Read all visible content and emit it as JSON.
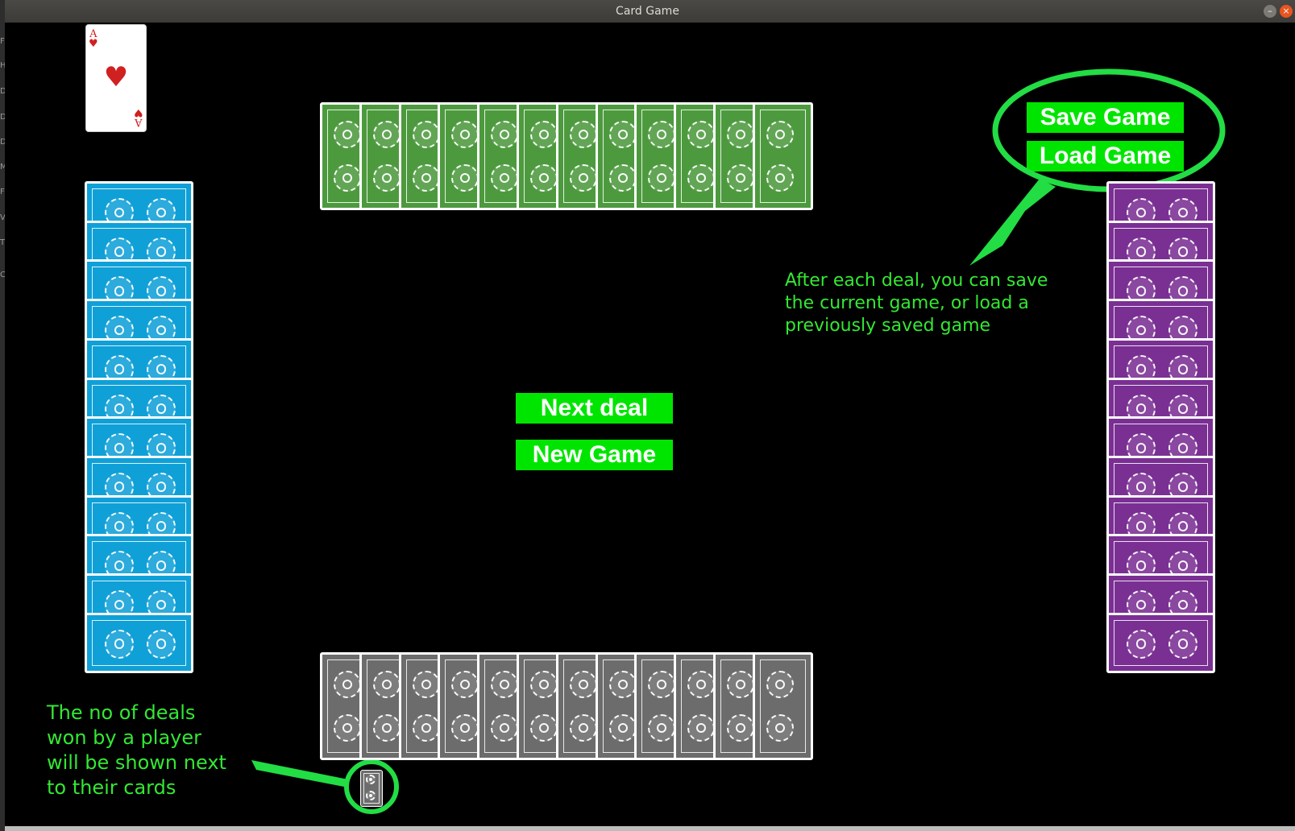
{
  "window": {
    "title": "Card Game",
    "minimize_glyph": "–",
    "close_glyph": "×"
  },
  "left_edge_letters": [
    "F",
    "H",
    "D",
    "D",
    "D",
    "M",
    "F",
    "V",
    "T",
    "C"
  ],
  "top_card": {
    "rank": "A",
    "suit": "♥",
    "suit_name": "hearts"
  },
  "buttons": {
    "save": "Save Game",
    "load": "Load Game",
    "next_deal": "Next deal",
    "new_game": "New Game"
  },
  "annotations": {
    "save_load": "After each deal, you can save\nthe current game, or load a\npreviously saved game",
    "deals_won": "The no of deals\nwon by a player\nwill be shown next\nto their cards"
  },
  "hands": {
    "top": {
      "color": "green",
      "count": 12
    },
    "bottom": {
      "color": "gray",
      "count": 12
    },
    "left": {
      "color": "blue",
      "count": 12
    },
    "right": {
      "color": "purple",
      "count": 12
    }
  },
  "deals_won_indicator": {
    "player": "bottom",
    "count": 1
  },
  "colors": {
    "background": "#000000",
    "button_green": "#00e500",
    "annotation_green": "#33e833",
    "card_green": "#4d9a3e",
    "card_gray": "#6c6c6c",
    "card_blue": "#0fa0d8",
    "card_purple": "#7a2f93",
    "heart_red": "#d02020"
  }
}
